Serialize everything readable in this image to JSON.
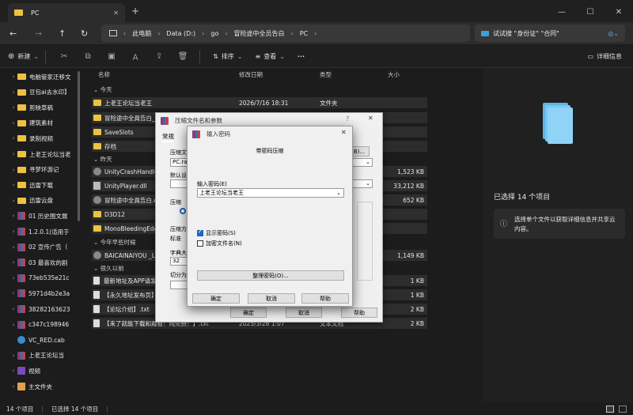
{
  "window": {
    "tab_title": "PC",
    "new_tab": "+",
    "minimize": "—",
    "maximize": "☐",
    "close": "✕"
  },
  "address": {
    "segments": [
      "此电脑",
      "Data (D:)",
      "go",
      "冒险途中全员告白",
      "PC"
    ],
    "search_placeholder": "试试搜 \"身份证\" \"合同\""
  },
  "toolbar": {
    "new_label": "新建",
    "sort_label": "排序",
    "view_label": "查看",
    "more": "···",
    "details_label": "详细信息"
  },
  "sidebar": {
    "items": [
      {
        "label": "电脑管家迁移文",
        "kind": "folder"
      },
      {
        "label": "豆包ai去水印】",
        "kind": "folder"
      },
      {
        "label": "剪映草稿",
        "kind": "folder"
      },
      {
        "label": "建筑素材",
        "kind": "folder"
      },
      {
        "label": "录制视频",
        "kind": "folder"
      },
      {
        "label": "上老王论坛当老",
        "kind": "folder"
      },
      {
        "label": "寻梦环游记",
        "kind": "folder"
      },
      {
        "label": "迅雷下载",
        "kind": "folder"
      },
      {
        "label": "迅雷云盘",
        "kind": "folder"
      },
      {
        "label": "01 历史图文展",
        "kind": "rar"
      },
      {
        "label": "1.2.0.1(适用于",
        "kind": "rar"
      },
      {
        "label": "02 宣传广告（",
        "kind": "rar"
      },
      {
        "label": "03 最喜欢的剧",
        "kind": "rar"
      },
      {
        "label": "73eb535e21c",
        "kind": "rar"
      },
      {
        "label": "5971d4b2e3a",
        "kind": "rar"
      },
      {
        "label": "38282163623",
        "kind": "rar"
      },
      {
        "label": "c347c198946",
        "kind": "rar"
      },
      {
        "label": "VC_RED.cab",
        "kind": "cab"
      },
      {
        "label": "上老王论坛当",
        "kind": "rar"
      },
      {
        "label": "视频",
        "kind": "video"
      },
      {
        "label": "主文件夹",
        "kind": "home"
      }
    ]
  },
  "list": {
    "headers": {
      "name": "名称",
      "date": "修改日期",
      "type": "类型",
      "size": "大小"
    },
    "groups": {
      "today": "今天",
      "yesterday": "昨天",
      "earlier_year": "今年早些时候",
      "long_ago": "很久以前"
    },
    "rows": [
      {
        "name": "上老王论坛当老王",
        "date": "2026/7/16 18:31",
        "type": "文件夹",
        "size": "",
        "icon": "folder"
      },
      {
        "name": "冒险途中全員告白_D",
        "date": "",
        "type": "",
        "size": "",
        "icon": "folder"
      },
      {
        "name": "SaveSlots",
        "date": "",
        "type": "",
        "size": "",
        "icon": "folder"
      },
      {
        "name": "存档",
        "date": "",
        "type": "",
        "size": "",
        "icon": "folder"
      },
      {
        "name": "UnityCrashHandler",
        "date": "",
        "type": "",
        "size": "1,523 KB",
        "icon": "gear"
      },
      {
        "name": "UnityPlayer.dll",
        "date": "",
        "type": "",
        "size": "33,212 KB",
        "icon": "dll"
      },
      {
        "name": "冒险途中全員告白.ex",
        "date": "",
        "type": "",
        "size": "652 KB",
        "icon": "exe"
      },
      {
        "name": "D3D12",
        "date": "",
        "type": "",
        "size": "",
        "icon": "folder"
      },
      {
        "name": "MonoBleedingEdge",
        "date": "",
        "type": "",
        "size": "",
        "icon": "folder"
      },
      {
        "name": "BAICAINAIYOU _Li",
        "date": "",
        "type": "",
        "size": "1,149 KB",
        "icon": "exe"
      },
      {
        "name": "最新地址及APP请发",
        "date": "",
        "type": "",
        "size": "1 KB",
        "icon": "doc"
      },
      {
        "name": "【永久地址发布页】",
        "date": "",
        "type": "",
        "size": "1 KB",
        "icon": "doc"
      },
      {
        "name": "【论坛介绍】.txt",
        "date": "",
        "type": "",
        "size": "2 KB",
        "icon": "doc"
      },
      {
        "name": "【来了就能下载和观看！纯免费！】.txt",
        "date": "2025/3/26 1:07",
        "type": "文本文档",
        "size": "2 KB",
        "icon": "doc"
      }
    ]
  },
  "details": {
    "selected": "已选择 14 个项目",
    "hint": "选择单个文件以获取详细信息并共享云内容。"
  },
  "status": {
    "count": "14 个项目",
    "selected": "已选择 14 个项目"
  },
  "archive_dialog": {
    "title": "压缩文件名和参数",
    "help_q": "?",
    "tab_general": "常规",
    "archive_name_label": "压缩文",
    "archive_name_value": "PC.rar",
    "browse_label": "B)...",
    "default_label": "默认设",
    "format_label": "压缩",
    "method_label": "压缩方",
    "method_value": "标准",
    "dict_label": "字典大",
    "dict_value": "32",
    "split_label": "切分为",
    "ok": "确定",
    "cancel": "取消",
    "help": "帮助"
  },
  "password_dialog": {
    "title": "输入密码",
    "subtitle": "带密码压缩",
    "input_label": "输入密码(E)",
    "input_value": "上老王论坛当老王",
    "show_password": "显示密码(S)",
    "show_password_checked": true,
    "encrypt_names": "加密文件名(N)",
    "encrypt_names_checked": false,
    "organize": "整理密码(O)...",
    "ok": "确定",
    "cancel": "取消",
    "help": "帮助"
  }
}
